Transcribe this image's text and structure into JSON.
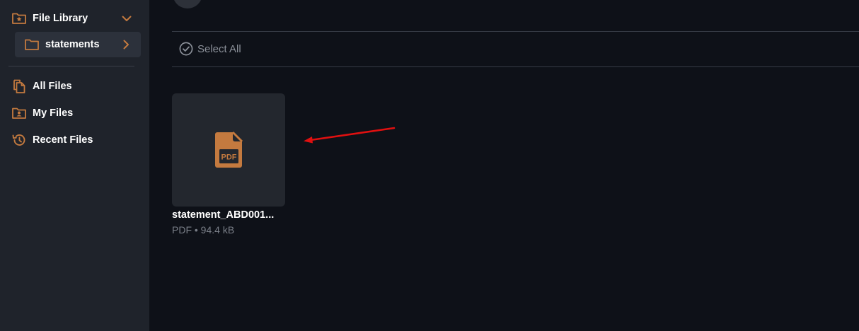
{
  "sidebar": {
    "file_library": "File Library",
    "current_folder": "statements",
    "items": [
      {
        "label": "All Files",
        "icon": "files-copy-icon"
      },
      {
        "label": "My Files",
        "icon": "user-folder-icon"
      },
      {
        "label": "Recent Files",
        "icon": "history-icon"
      }
    ]
  },
  "toolbar": {
    "select_all": "Select All"
  },
  "files": [
    {
      "name": "statement_ABD001...",
      "type": "PDF",
      "size": "94.4 kB",
      "meta": "PDF • 94.4 kB",
      "icon_label": "PDF"
    }
  ],
  "colors": {
    "accent": "#c47a3f",
    "sidebar_bg": "#1f232b",
    "main_bg": "#0e1118",
    "card_bg": "#23272e",
    "annotation_arrow": "#e01010"
  }
}
